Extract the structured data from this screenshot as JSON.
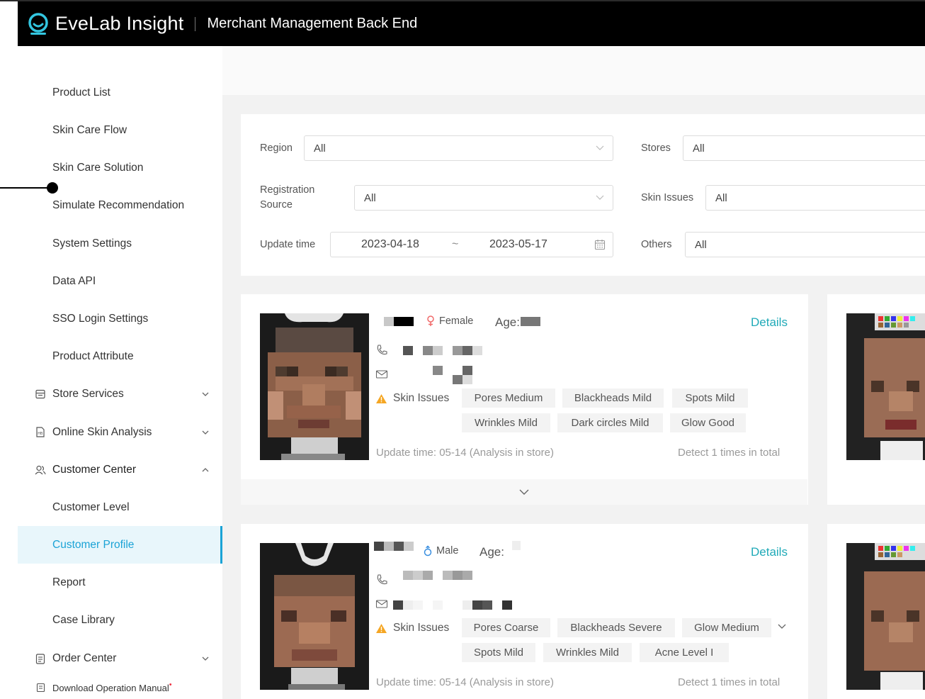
{
  "header": {
    "brand": "EveLab Insight",
    "subtitle": "Merchant Management Back End"
  },
  "sidebar": {
    "items": [
      {
        "label": "Product List"
      },
      {
        "label": "Skin Care Flow"
      },
      {
        "label": "Skin Care Solution"
      },
      {
        "label": "Simulate Recommendation"
      },
      {
        "label": "System Settings"
      },
      {
        "label": "Data API"
      },
      {
        "label": "SSO Login Settings"
      },
      {
        "label": "Product Attribute"
      },
      {
        "label": "Store Services",
        "icon": "store-icon",
        "expanded": false
      },
      {
        "label": "Online Skin Analysis",
        "icon": "document-icon",
        "expanded": false
      },
      {
        "label": "Customer Center",
        "icon": "users-icon",
        "expanded": true
      },
      {
        "label": "Customer Level"
      },
      {
        "label": "Customer Profile",
        "active": true
      },
      {
        "label": "Report"
      },
      {
        "label": "Case Library"
      },
      {
        "label": "Order Center",
        "icon": "clipboard-icon",
        "expanded": false
      },
      {
        "label": "Download Operation Manual",
        "icon": "manual-icon",
        "badge": "•"
      }
    ]
  },
  "filters": {
    "region": {
      "label": "Region",
      "value": "All"
    },
    "stores": {
      "label": "Stores",
      "value": "All"
    },
    "registration_source": {
      "label_line1": "Registration",
      "label_line2": "Source",
      "value": "All"
    },
    "skin_issues": {
      "label": "Skin Issues",
      "value": "All"
    },
    "update_time": {
      "label": "Update time",
      "start": "2023-04-18",
      "separator": "~",
      "end": "2023-05-17"
    },
    "others": {
      "label": "Others",
      "value": "All"
    }
  },
  "customers": [
    {
      "gender": "Female",
      "age_label": "Age:",
      "details": "Details",
      "skin_issues_label": "Skin Issues",
      "tags": [
        "Pores Medium",
        "Blackheads Mild",
        "Spots Mild",
        "Wrinkles Mild",
        "Dark circles Mild",
        "Glow Good"
      ],
      "update_time": "Update time: 05-14 (Analysis in store)",
      "detect": "Detect 1 times in total"
    },
    {
      "gender": "Male",
      "age_label": "Age:",
      "details": "Details",
      "skin_issues_label": "Skin Issues",
      "tags": [
        "Pores Coarse",
        "Blackheads Severe",
        "Glow Medium",
        "Spots Mild",
        "Wrinkles Mild",
        "Acne Level  I"
      ],
      "update_time": "Update time: 05-14 (Analysis in store)",
      "detect": "Detect 1 times in total"
    }
  ],
  "colors": {
    "accent": "#1ba3d6",
    "details": "#20aab8",
    "warning": "#f5a623",
    "header_bg": "#000000"
  }
}
